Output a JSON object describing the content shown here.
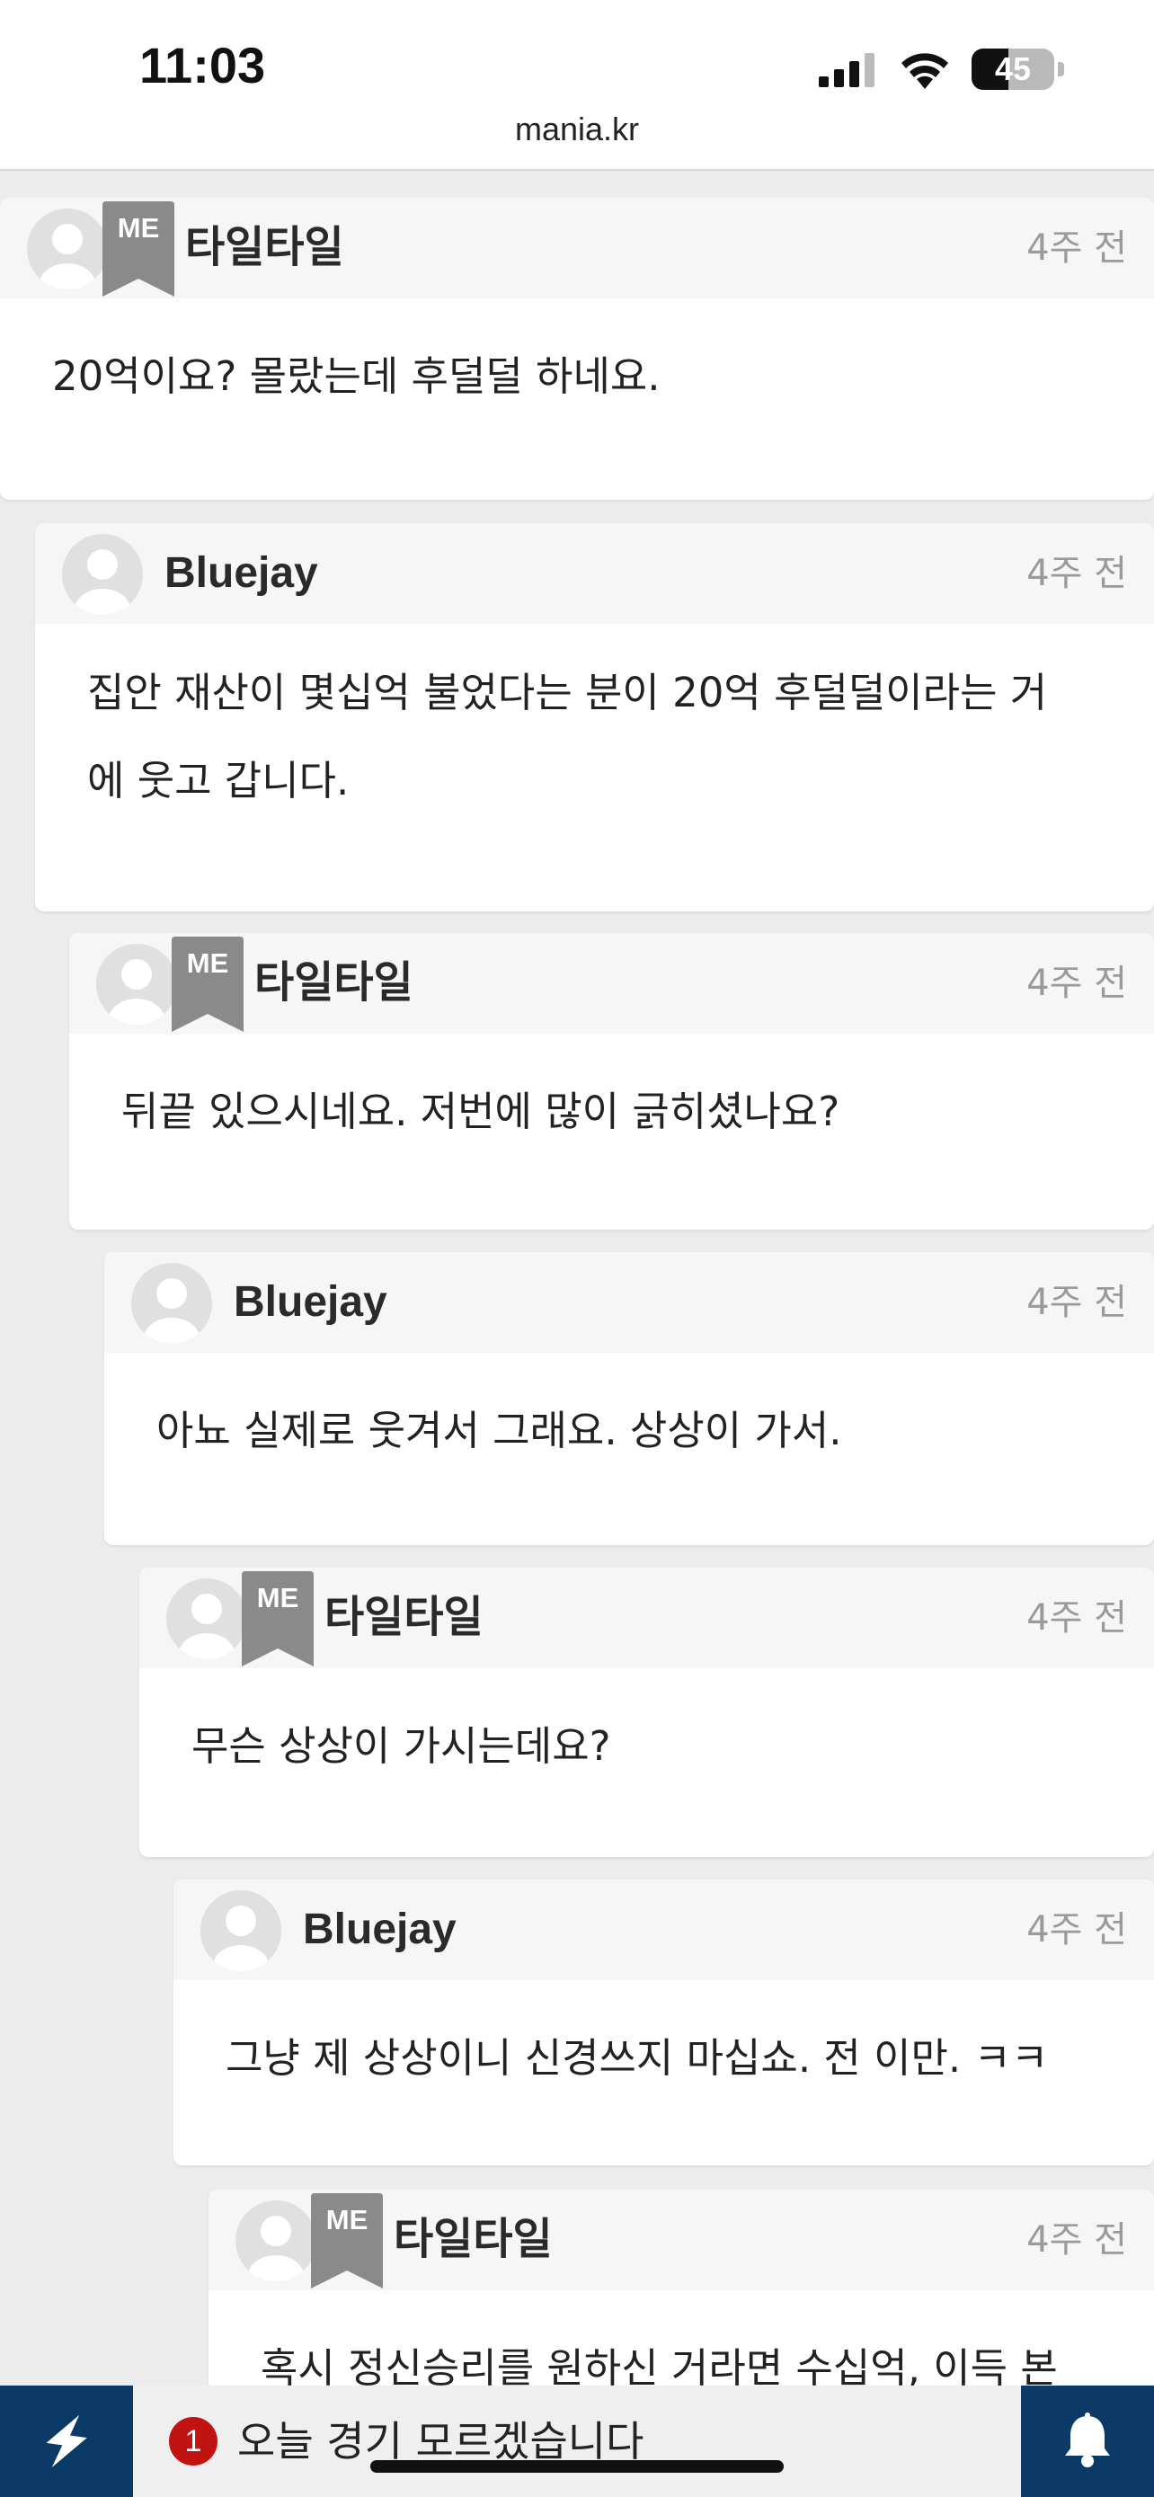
{
  "status_bar": {
    "time": "11:03",
    "url": "mania.kr",
    "battery": {
      "percent": 45,
      "label": "45"
    }
  },
  "colors": {
    "nav_bg": "#0b3a66",
    "badge_gray": "#8a8a8a",
    "notice_red": "#c21313"
  },
  "me_badge_label": "ME",
  "comments": [
    {
      "author": "타일타일",
      "is_me": true,
      "time": "4주 전",
      "lines": [
        "20억이요? 몰랐는데 후덜덜 하네요."
      ]
    },
    {
      "author": "Bluejay",
      "is_me": false,
      "time": "4주 전",
      "lines": [
        "집안 재산이 몇십억 불었다는 분이 20억 후덜덜이라는 거",
        "에 웃고 갑니다."
      ]
    },
    {
      "author": "타일타일",
      "is_me": true,
      "time": "4주 전",
      "lines": [
        "뒤끝 있으시네요. 저번에 많이 긁히셨나요?"
      ]
    },
    {
      "author": "Bluejay",
      "is_me": false,
      "time": "4주 전",
      "lines": [
        "아뇨 실제로 웃겨서 그래요. 상상이 가서."
      ]
    },
    {
      "author": "타일타일",
      "is_me": true,
      "time": "4주 전",
      "lines": [
        "무슨 상상이 가시는데요?"
      ]
    },
    {
      "author": "Bluejay",
      "is_me": false,
      "time": "4주 전",
      "lines": [
        "그냥 제 상상이니 신경쓰지 마십쇼. 전 이만. ㅋㅋ"
      ]
    },
    {
      "author": "타일타일",
      "is_me": true,
      "time": "4주 전",
      "lines": [
        "혹시 정신승리를 원하신 거라면 수십억, 이득 본"
      ]
    }
  ],
  "bottom_bar": {
    "left_icon": "lightning-icon",
    "notice_count": "1",
    "notice_text": "오늘 경기 모르겠습니다",
    "right_icon": "bell-icon"
  }
}
